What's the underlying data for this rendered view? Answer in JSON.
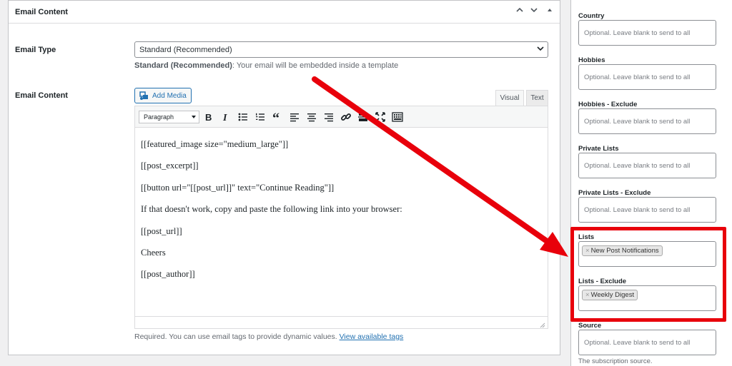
{
  "postbox": {
    "title": "Email Content"
  },
  "email_type": {
    "label": "Email Type",
    "selected": "Standard (Recommended)",
    "desc_bold": "Standard (Recommended)",
    "desc_rest": ": Your email will be embedded inside a template"
  },
  "email_content": {
    "label": "Email Content",
    "add_media_label": "Add Media",
    "tab_visual": "Visual",
    "tab_text": "Text",
    "format_select": "Paragraph",
    "toolbar_icons": [
      "bold-icon",
      "italic-icon",
      "bullet-list-icon",
      "numbered-list-icon",
      "blockquote-icon",
      "align-left-icon",
      "align-center-icon",
      "align-right-icon",
      "link-icon",
      "more-tag-icon",
      "fullscreen-icon",
      "toolbar-toggle-icon"
    ],
    "lines": [
      "[[featured_image size=\"medium_large\"]]",
      "[[post_excerpt]]",
      "[[button url=\"[[post_url]]\" text=\"Continue Reading\"]]",
      "If that doesn't work, copy and paste the following link into your browser:",
      "[[post_url]]",
      "Cheers",
      "[[post_author]]"
    ],
    "help_text": "Required. You can use email tags to provide dynamic values. ",
    "help_link": "View available tags"
  },
  "sidebar": {
    "fields": [
      {
        "label": "Country",
        "placeholder": "Optional. Leave blank to send to all"
      },
      {
        "label": "Hobbies",
        "placeholder": "Optional. Leave blank to send to all"
      },
      {
        "label": "Hobbies - Exclude",
        "placeholder": "Optional. Leave blank to send to all"
      },
      {
        "label": "Private Lists",
        "placeholder": "Optional. Leave blank to send to all"
      },
      {
        "label": "Private Lists - Exclude",
        "placeholder": "Optional. Leave blank to send to all"
      },
      {
        "label": "Lists",
        "tag": "New Post Notifications"
      },
      {
        "label": "Lists - Exclude",
        "tag": "Weekly Digest"
      },
      {
        "label": "Source",
        "placeholder": "Optional. Leave blank to send to all",
        "desc": "The subscription source."
      }
    ],
    "tag_remove_symbol": "×"
  },
  "colors": {
    "annotation_red": "#e8000b",
    "link_blue": "#2271b1"
  }
}
